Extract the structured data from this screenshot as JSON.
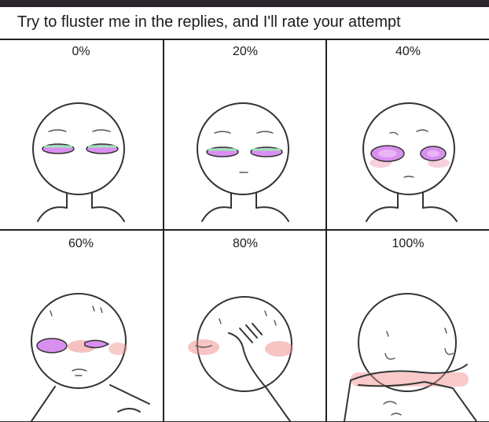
{
  "caption": "Try to fluster me in the replies, and I'll rate your attempt",
  "panels": [
    {
      "label": "0%"
    },
    {
      "label": "20%"
    },
    {
      "label": "40%"
    },
    {
      "label": "60%"
    },
    {
      "label": "80%"
    },
    {
      "label": "100%"
    }
  ],
  "colors": {
    "eye_iris": "#d98ff0",
    "eye_green": "#9be7b5",
    "blush": "#f08a8a",
    "line": "#333333",
    "outer_bg": "#2a262b"
  }
}
